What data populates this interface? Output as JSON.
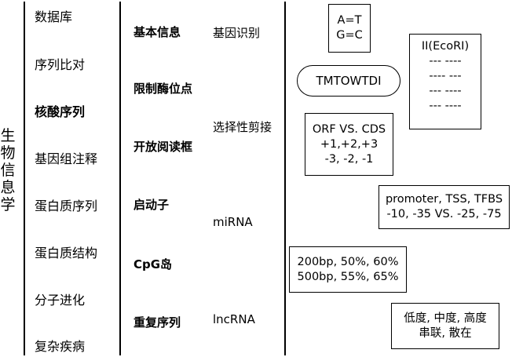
{
  "root_label": "生物信息学",
  "categories": [
    {
      "label": "数据库",
      "bold": false
    },
    {
      "label": "序列比对",
      "bold": false
    },
    {
      "label": "核酸序列",
      "bold": true
    },
    {
      "label": "基因组注释",
      "bold": false
    },
    {
      "label": "蛋白质序列",
      "bold": false
    },
    {
      "label": "蛋白质结构",
      "bold": false
    },
    {
      "label": "分子进化",
      "bold": false
    },
    {
      "label": "复杂疾病",
      "bold": false
    }
  ],
  "subtopics": [
    "基本信息",
    "限制酶位点",
    "开放阅读框",
    "启动子",
    "CpG岛",
    "重复序列"
  ],
  "extra_topics": [
    "基因识别",
    "选择性剪接",
    "miRNA",
    "lncRNA"
  ],
  "notes": {
    "base_pairing": [
      "A=T",
      "G=C"
    ],
    "restriction_pill": "TMTOWTDI",
    "ecori": [
      "II(EcoRI)",
      "--- ----",
      "---- ---",
      "--- ----",
      "--- ----"
    ],
    "orf": [
      "ORF VS. CDS",
      "+1,+2,+3",
      "-3, -2, -1"
    ],
    "promoter": [
      "promoter, TSS, TFBS",
      "-10, -35 VS. -25, -75"
    ],
    "cpg": [
      "200bp, 50%, 60%",
      "500bp, 55%, 65%"
    ],
    "repeats": [
      "低度, 中度, 高度",
      "串联, 散在"
    ]
  }
}
